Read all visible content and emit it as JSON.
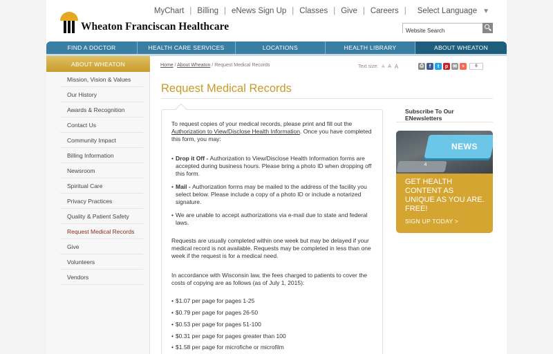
{
  "brand": {
    "name": "Wheaton Franciscan Healthcare"
  },
  "top_nav": [
    "MyChart",
    "Billing",
    "eNews Sign Up",
    "Classes",
    "Give",
    "Careers"
  ],
  "language_selector": "Select Language",
  "search": {
    "value": "Website Search"
  },
  "main_nav": [
    {
      "label": "FIND A DOCTOR"
    },
    {
      "label": "HEALTH CARE SERVICES"
    },
    {
      "label": "LOCATIONS"
    },
    {
      "label": "HEALTH LIBRARY"
    },
    {
      "label": "ABOUT WHEATON"
    }
  ],
  "sidebar": {
    "header": "ABOUT WHEATON",
    "items": [
      "Mission, Vision & Values",
      "Our History",
      "Awards & Recognition",
      "Contact Us",
      "Community Impact",
      "Billing Information",
      "Newsroom",
      "Spiritual Care",
      "Privacy Practices",
      "Quality & Patient Safety",
      "Request Medical Records",
      "Give",
      "Volunteers",
      "Vendors"
    ]
  },
  "breadcrumb": {
    "home": "Home",
    "sep1": " / ",
    "about": "About Wheaton",
    "current": " / Request Medical Records"
  },
  "text_size": {
    "label": "Text size:",
    "a_small": "A",
    "a_medium": "A",
    "a_large": "A"
  },
  "share": {
    "count": "6"
  },
  "page_title": "Request Medical Records",
  "content": {
    "intro_1": "To request copies of your medical records, please print and fill out the",
    "intro_link": "Authorization to View/Disclose Health Information",
    "intro_2": ". Once you have completed this form, you may:",
    "drop_bold": "Drop it Off - ",
    "drop_text": "Authorization to View/Disclose Health Information forms are accepted during business hours. Please bring a photo ID when dropping off this form.",
    "mail_bold": "Mail - ",
    "mail_text": "Authorization forms may be mailed to the address of the facility you select below. Please include a copy of a photo ID or include a notarized signature.",
    "email_text": "We are unable to accept authorizations via e-mail due to state and federal laws.",
    "timing": "Requests are usually completed within one week but may be delayed if your medical record is not available. Requests may be completed in less than one week if the request is for a medical need.",
    "fees_intro": "In accordance with Wisconsin law, the fees charged to patients to cover the costs of copying are as follows (as of July 1, 2015):",
    "fees": [
      "$1.07 per page for pages 1-25",
      "$0.79 per page for pages 26-50",
      "$0.53 per page for pages 51-100",
      "$0.31 per page for pages greater than 100",
      "$1.58 per page for microfiche or microfilm"
    ]
  },
  "newsletter": {
    "title": "Subscribe To Our ENewsletters",
    "key_label": "NEWS",
    "small_key": "4",
    "headline": "GET HEALTH CONTENT AS UNIQUE AS YOU ARE. FREE!",
    "cta": "SIGN UP TODAY >"
  }
}
